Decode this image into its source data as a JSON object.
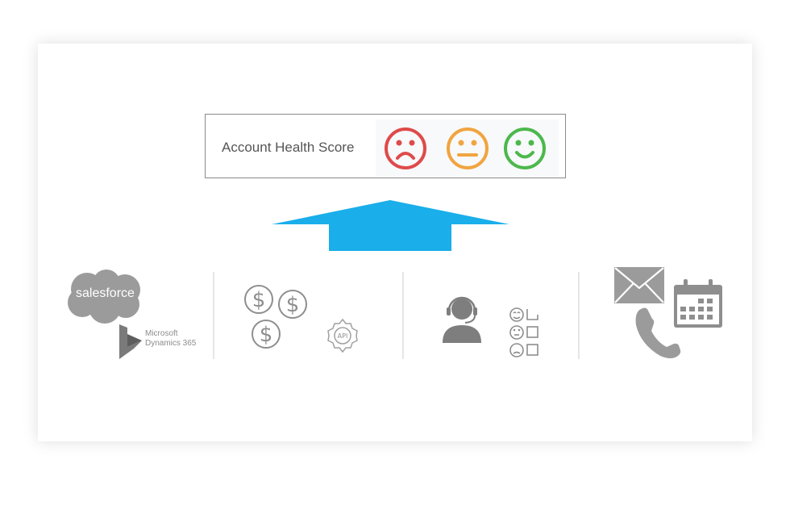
{
  "diagram": {
    "title": "Account Health Score",
    "health_faces": [
      {
        "name": "sad",
        "color": "#df4a4a"
      },
      {
        "name": "neutral",
        "color": "#f0a540"
      },
      {
        "name": "happy",
        "color": "#4cb84c"
      }
    ],
    "arrow_color": "#1aaeea",
    "icon_color": "#8e8e8e",
    "sources": [
      {
        "group": "crm",
        "items": [
          "salesforce",
          "Microsoft Dynamics 365"
        ],
        "salesforce_label": "salesforce",
        "microsoft_label": "Microsoft",
        "dynamics_label": "Dynamics 365"
      },
      {
        "group": "billing",
        "items": [
          "dollar-coins",
          "API"
        ],
        "api_label": "API"
      },
      {
        "group": "support",
        "items": [
          "support-agent",
          "survey-checklist"
        ]
      },
      {
        "group": "engagement",
        "items": [
          "email",
          "calendar",
          "phone"
        ]
      }
    ]
  }
}
